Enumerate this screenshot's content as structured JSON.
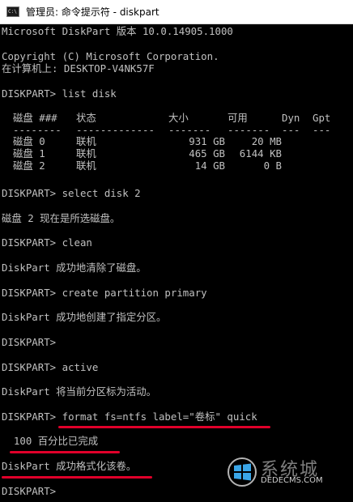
{
  "window": {
    "icon": "cmd-icon",
    "icon_text": "C:\\",
    "title": "管理员: 命令提示符 - diskpart"
  },
  "console": {
    "lines": {
      "version": "Microsoft DiskPart 版本 10.0.14905.1000",
      "copyright": "Copyright (C) Microsoft Corporation.",
      "computer": "在计算机上: DESKTOP-V4NK57F",
      "cmd_list_disk": "DISKPART> list disk",
      "cmd_select": "DISKPART> select disk 2",
      "select_result": "磁盘 2 现在是所选磁盘。",
      "cmd_clean": "DISKPART> clean",
      "clean_result": "DiskPart 成功地清除了磁盘。",
      "cmd_create": "DISKPART> create partition primary",
      "create_result": "DiskPart 成功地创建了指定分区。",
      "prompt_empty1": "DISKPART>",
      "cmd_active": "DISKPART> active",
      "active_result": "DiskPart 将当前分区标为活动。",
      "cmd_format_prompt": "DISKPART> ",
      "cmd_format": "format fs=ntfs label=\"卷标\" quick",
      "format_progress": "  100 百分比已完成",
      "format_result": "DiskPart 成功格式化该卷。",
      "prompt_final": "DISKPART>"
    },
    "disk_table": {
      "headers": {
        "disk": "磁盘 ###",
        "status": "状态",
        "size": "大小",
        "free": "可用",
        "dyn": "Dyn",
        "gpt": "Gpt"
      },
      "separators": {
        "disk": "--------",
        "status": "-------------",
        "size": "-------",
        "free": "-------",
        "dyn": "---",
        "gpt": "---"
      },
      "rows": [
        {
          "disk": "磁盘 0",
          "status": "联机",
          "size": "931 GB",
          "free": "20 MB",
          "dyn": "",
          "gpt": ""
        },
        {
          "disk": "磁盘 1",
          "status": "联机",
          "size": "465 GB",
          "free": "6144 KB",
          "dyn": "",
          "gpt": ""
        },
        {
          "disk": "磁盘 2",
          "status": "联机",
          "size": "14 GB",
          "free": "0 B",
          "dyn": "",
          "gpt": ""
        }
      ]
    }
  },
  "colors": {
    "console_bg": "#000000",
    "console_text": "#c0c0c0",
    "underline": "#e0002a"
  },
  "watermark": {
    "logo_icon": "windows-logo-icon",
    "site_big": "系统城",
    "site_url": "DEDECMS.COM"
  }
}
